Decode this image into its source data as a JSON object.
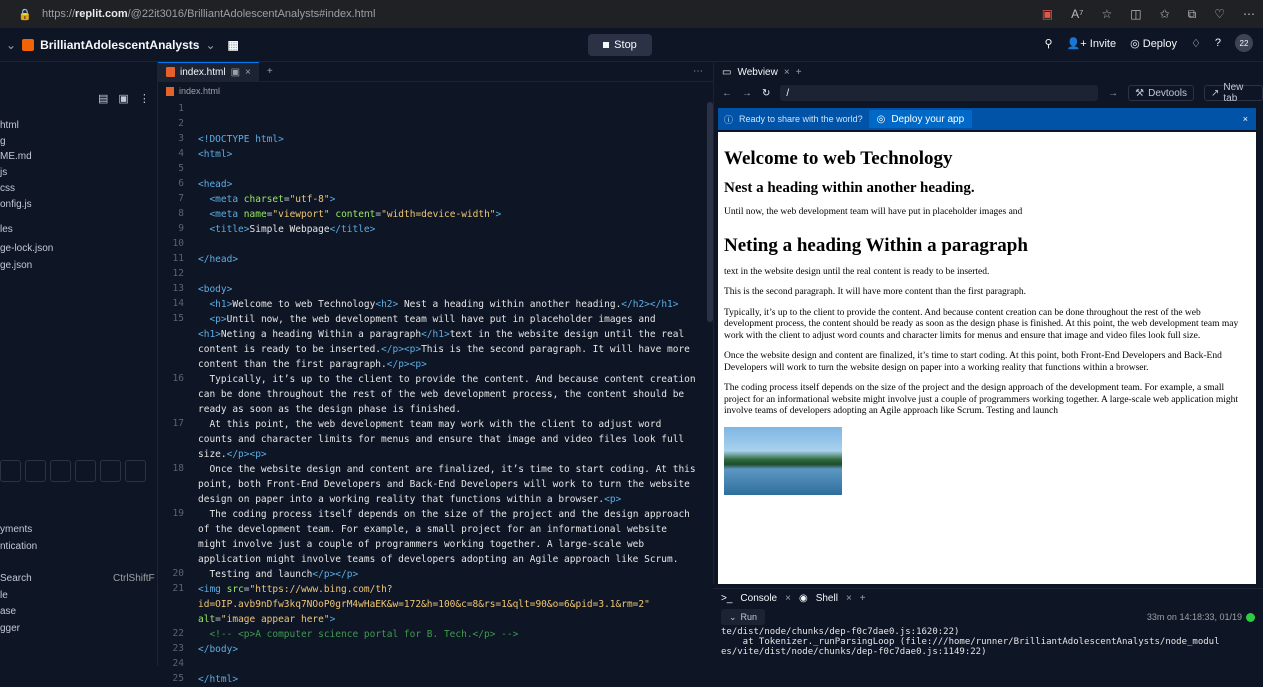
{
  "browser": {
    "url_prefix": "https://",
    "url_domain": "replit.com",
    "url_path": "/@22it3016/BrilliantAdolescentAnalysts#index.html",
    "icons": [
      "tab-icon",
      "read-aloud-icon",
      "favorite-icon",
      "split-icon",
      "favorites-icon",
      "collections-icon",
      "copilot-icon",
      "more-icon"
    ]
  },
  "topbar": {
    "project_name": "BrilliantAdolescentAnalysts",
    "stop_label": "Stop",
    "invite_label": "Invite",
    "deploy_label": "Deploy",
    "help_label": "?",
    "avatar_initials": "22"
  },
  "sidebar": {
    "files": [
      "html",
      "g",
      "ME.md",
      "js",
      "css",
      "onfig.js",
      "les",
      "ge-lock.json",
      "ge.json"
    ],
    "sections": [
      "yments",
      "ntication"
    ],
    "tools": [
      {
        "label": "Search",
        "shortcut": "CtrlShiftF"
      },
      {
        "label": "le",
        "shortcut": ""
      },
      {
        "label": "ase",
        "shortcut": ""
      },
      {
        "label": "gger",
        "shortcut": ""
      }
    ]
  },
  "editor": {
    "tab_label": "index.html",
    "breadcrumb": "index.html",
    "lines": [
      {
        "n": "1",
        "html": ""
      },
      {
        "n": "2",
        "html": ""
      },
      {
        "n": "3",
        "html": "<span class='tg'>&lt;!DOCTYPE html&gt;</span>"
      },
      {
        "n": "4",
        "html": "<span class='tg'>&lt;html&gt;</span>"
      },
      {
        "n": "5",
        "html": ""
      },
      {
        "n": "6",
        "html": "<span class='tg'>&lt;head&gt;</span>"
      },
      {
        "n": "7",
        "html": "  <span class='tg'>&lt;meta</span> <span class='at'>charset</span>=<span class='st'>\"utf-8\"</span><span class='tg'>&gt;</span>"
      },
      {
        "n": "8",
        "html": "  <span class='tg'>&lt;meta</span> <span class='at'>name</span>=<span class='st'>\"viewport\"</span> <span class='at'>content</span>=<span class='st'>\"width=device-width\"</span><span class='tg'>&gt;</span>"
      },
      {
        "n": "9",
        "html": "  <span class='tg'>&lt;title&gt;</span><span class='tx'>Simple Webpage</span><span class='tg'>&lt;/title&gt;</span>"
      },
      {
        "n": "10",
        "html": ""
      },
      {
        "n": "11",
        "html": "<span class='tg'>&lt;/head&gt;</span>"
      },
      {
        "n": "12",
        "html": ""
      },
      {
        "n": "13",
        "html": "<span class='tg'>&lt;body&gt;</span>"
      },
      {
        "n": "14",
        "html": "  <span class='tg'>&lt;h1&gt;</span><span class='tx'>Welcome to web Technology</span><span class='tg'>&lt;h2&gt;</span><span class='tx'> Nest a heading within another heading.</span><span class='tg'>&lt;/h2&gt;&lt;/h1&gt;</span>"
      },
      {
        "n": "15",
        "html": "  <span class='tg'>&lt;p&gt;</span><span class='tx'>Until now, the web development team will have put in placeholder images and</span>\n<span class='tg'>&lt;h1&gt;</span><span class='tx'>Neting a heading Within a paragraph</span><span class='tg'>&lt;/h1&gt;</span><span class='tx'>text in the website design until the real</span>\n<span class='tx'>content is ready to be inserted.</span><span class='tg'>&lt;/p&gt;&lt;p&gt;</span><span class='tx'>This is the second paragraph. It will have more</span>\n<span class='tx'>content than the first paragraph.</span><span class='tg'>&lt;/p&gt;&lt;p&gt;</span>"
      },
      {
        "n": "16",
        "html": "  <span class='tx'>Typically, it’s up to the client to provide the content. And because content creation</span>\n<span class='tx'>can be done throughout the rest of the web development process, the content should be</span>\n<span class='tx'>ready as soon as the design phase is finished.</span>"
      },
      {
        "n": "17",
        "html": "  <span class='tx'>At this point, the web development team may work with the client to adjust word</span>\n<span class='tx'>counts and character limits for menus and ensure that image and video files look full</span>\n<span class='tx'>size.</span><span class='tg'>&lt;/p&gt;&lt;p&gt;</span>"
      },
      {
        "n": "18",
        "html": "  <span class='tx'>Once the website design and content are finalized, it’s time to start coding. At this</span>\n<span class='tx'>point, both Front-End Developers and Back-End Developers will work to turn the website</span>\n<span class='tx'>design on paper into a working reality that functions within a browser.</span><span class='tg'>&lt;p&gt;</span>"
      },
      {
        "n": "19",
        "html": "  <span class='tx'>The coding process itself depends on the size of the project and the design approach</span>\n<span class='tx'>of the development team. For example, a small project for an informational website</span>\n<span class='tx'>might involve just a couple of programmers working together. A large-scale web</span>\n<span class='tx'>application might involve teams of developers adopting an Agile approach like Scrum.</span>"
      },
      {
        "n": "20",
        "html": "  <span class='tx'>Testing and launch</span><span class='tg'>&lt;/p&gt;&lt;/p&gt;</span>"
      },
      {
        "n": "21",
        "html": "<span class='tg'>&lt;img</span> <span class='at'>src</span>=<span class='st'>\"https://www.bing.com/th?</span>\n<span class='st'>id=OIP.avb9nDfw3kq7NOoP0grM4wHaEK&amp;w=172&amp;h=100&amp;c=8&amp;rs=1&amp;qlt=90&amp;o=6&amp;pid=3.1&amp;rm=2\"</span>\n<span class='at'>alt</span>=<span class='st'>\"image appear here\"</span><span class='tg'>&gt;</span>"
      },
      {
        "n": "22",
        "html": "  <span class='cm'>&lt;!-- &lt;p&gt;A computer science portal for B. Tech.&lt;/p&gt; --&gt;</span>"
      },
      {
        "n": "23",
        "html": "<span class='tg'>&lt;/body&gt;</span>"
      },
      {
        "n": "24",
        "html": ""
      },
      {
        "n": "25",
        "html": "<span class='tg'>&lt;/html&gt;</span>"
      }
    ]
  },
  "webview": {
    "tab_label": "Webview",
    "address": "/",
    "devtools_label": "Devtools",
    "newtab_label": "New tab",
    "banner_text": "Ready to share with the world?",
    "banner_button": "Deploy your app",
    "page": {
      "h1_a": "Welcome to web Technology",
      "h2": "Nest a heading within another heading.",
      "p1": "Until now, the web development team will have put in placeholder images and",
      "h1_b": "Neting a heading Within a paragraph",
      "p2": "text in the website design until the real content is ready to be inserted.",
      "p3": "This is the second paragraph. It will have more content than the first paragraph.",
      "p4": "Typically, it’s up to the client to provide the content. And because content creation can be done throughout the rest of the web development process, the content should be ready as soon as the design phase is finished. At this point, the web development team may work with the client to adjust word counts and character limits for menus and ensure that image and video files look full size.",
      "p5": "Once the website design and content are finalized, it’s time to start coding. At this point, both Front-End Developers and Back-End Developers will work to turn the website design on paper into a working reality that functions within a browser.",
      "p6": "The coding process itself depends on the size of the project and the design approach of the development team. For example, a small project for an informational website might involve just a couple of programmers working together. A large-scale web application might involve teams of developers adopting an Agile approach like Scrum. Testing and launch"
    }
  },
  "console": {
    "tab_console": "Console",
    "tab_shell": "Shell",
    "run_label": "Run",
    "time": "33m on 14:18:33, 01/19",
    "log": "te/dist/node/chunks/dep-f0c7dae0.js:1620:22)\n    at Tokenizer._runParsingLoop (file:///home/runner/BrilliantAdolescentAnalysts/node_modul\nes/vite/dist/node/chunks/dep-f0c7dae0.js:1149:22)"
  }
}
